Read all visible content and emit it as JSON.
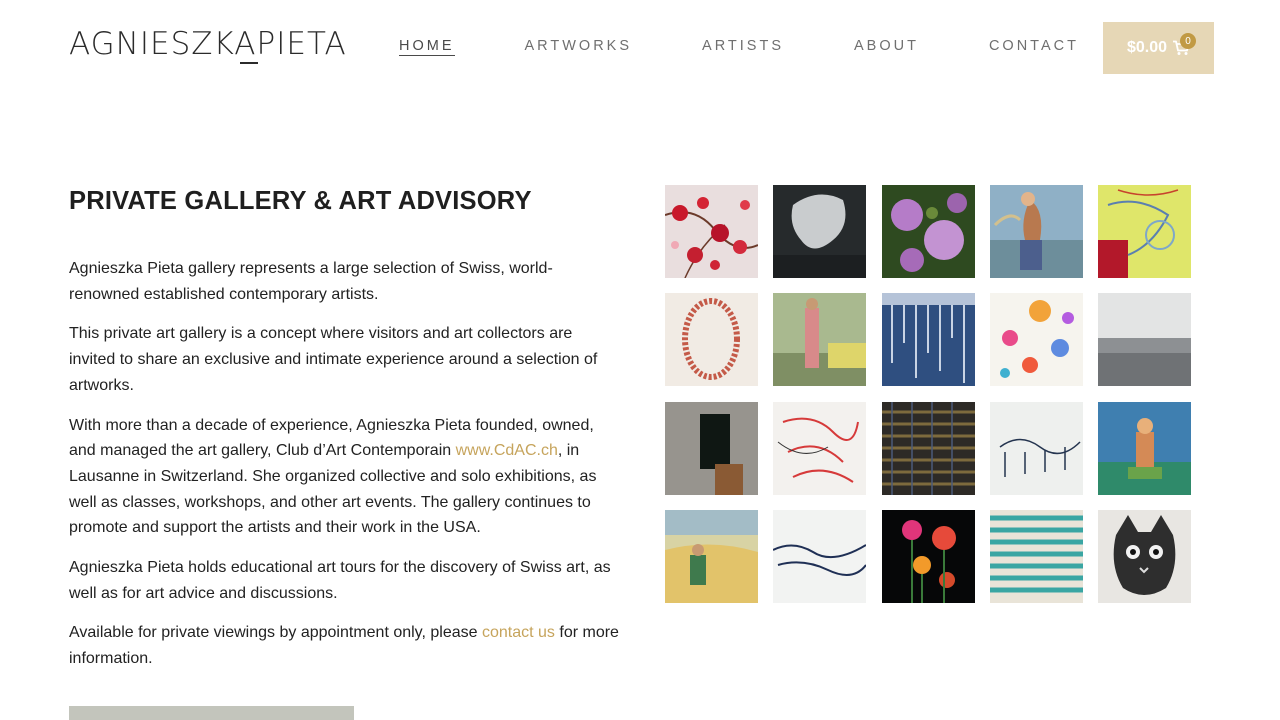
{
  "header": {
    "logo_text_first": "AGNIESZKA",
    "logo_text_second": "PIETA",
    "nav": [
      {
        "label": "HOME",
        "active": true
      },
      {
        "label": "ARTWORKS",
        "active": false
      },
      {
        "label": "ARTISTS",
        "active": false
      },
      {
        "label": "ABOUT",
        "active": false
      },
      {
        "label": "CONTACT",
        "active": false
      }
    ],
    "cart": {
      "total": "$0.00",
      "count": "0",
      "icon": "cart-icon"
    }
  },
  "main": {
    "title": "PRIVATE GALLERY & ART ADVISORY",
    "p1": "Agnieszka Pieta gallery represents a large selection of Swiss, world-renowned established contemporary artists.",
    "p2": "This private art gallery is a concept where visitors and art collectors are invited to share an exclusive and intimate experience around a selection of artworks.",
    "p3_before": "With more than a decade of experience, Agnieszka Pieta founded, owned, and managed the art gallery, Club d’Art Contemporain ",
    "p3_link": "www.CdAC.ch",
    "p3_after": ", in Lausanne in Switzerland.  She organized collective and solo exhibitions, as well as classes, workshops, and other art events. The gallery continues to promote and support the artists and their work in the USA.",
    "p4": "Agnieszka Pieta holds educational art tours for the discovery of Swiss art, as well as for art advice and discussions.",
    "p5_before": "Available for private viewings by appointment only, please ",
    "p5_link": "contact us",
    "p5_after": " for more information."
  },
  "colors": {
    "accent_gold": "#c6a45c",
    "cart_bg": "#e6d7b6",
    "badge": "#c19a44",
    "button_gray": "#c3c5bc"
  },
  "gallery": [
    {
      "name": "artwork-red-blossoms"
    },
    {
      "name": "artwork-dark-abstract"
    },
    {
      "name": "artwork-lilac-flowers"
    },
    {
      "name": "artwork-golfer"
    },
    {
      "name": "artwork-yellow-abstract"
    },
    {
      "name": "artwork-red-circle-drawing"
    },
    {
      "name": "artwork-figure-with-car"
    },
    {
      "name": "artwork-blue-drips"
    },
    {
      "name": "artwork-colorful-flowers"
    },
    {
      "name": "artwork-gray-landscape"
    },
    {
      "name": "artwork-dark-doorway"
    },
    {
      "name": "artwork-red-sketch"
    },
    {
      "name": "artwork-striped-abstract"
    },
    {
      "name": "artwork-ink-sketch"
    },
    {
      "name": "artwork-seated-woman"
    },
    {
      "name": "artwork-woman-in-field"
    },
    {
      "name": "artwork-ink-landscape"
    },
    {
      "name": "artwork-dark-bouquet"
    },
    {
      "name": "artwork-teal-stripes"
    },
    {
      "name": "artwork-cat-portrait"
    }
  ]
}
